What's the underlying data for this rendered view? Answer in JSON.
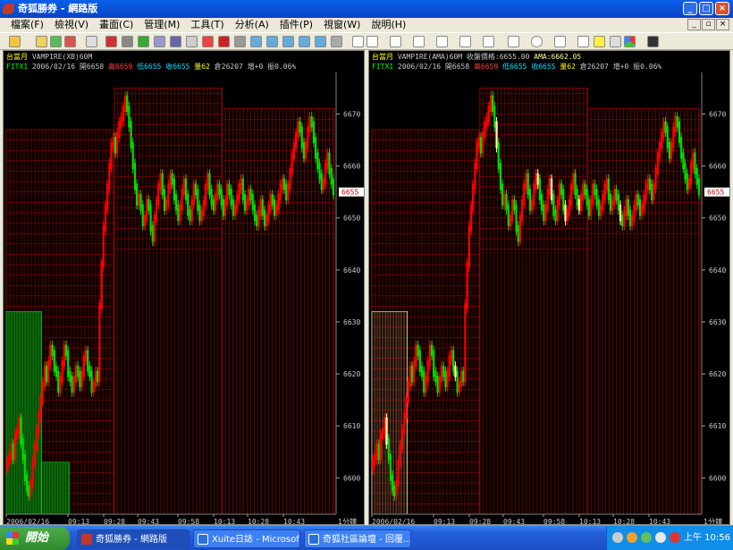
{
  "window": {
    "title": "奇狐勝券 - 網路版"
  },
  "menu": [
    "檔案(F)",
    "檢視(V)",
    "畫面(C)",
    "管理(M)",
    "工具(T)",
    "分析(A)",
    "插件(P)",
    "視窗(W)",
    "說明(H)"
  ],
  "colors": {
    "up": "#ff0000",
    "down": "#00dd00",
    "ama": "#ffffaa",
    "grid": "#c80000",
    "text_green": "#00ff00",
    "axis_label": "#c8c8c8"
  },
  "chart_left": {
    "name": "台當月",
    "indicator": "VAMPIRE(XB)60M",
    "symbol": "FITX1",
    "date": "2006/02/16",
    "open": "開6658",
    "high": "高6659",
    "low": "低6655",
    "close": "收6655",
    "volume": "量62",
    "oi": "倉26207",
    "oi_chg": "增+0",
    "amp": "振0.06%"
  },
  "chart_right": {
    "name": "台當月",
    "indicator": "VAMPIRE(AMA)60M",
    "close_label": "收盤價格:6655.00",
    "ama_label": "AMA:6662.05",
    "symbol": "FITX1",
    "date": "2006/02/16",
    "open": "開6658",
    "high": "高6659",
    "low": "低6655",
    "close": "收6655",
    "volume": "量62",
    "oi": "倉26207",
    "oi_chg": "增+0",
    "amp": "振0.06%"
  },
  "chart_data": {
    "type": "candlestick",
    "y_ticks": [
      6600,
      6610,
      6620,
      6630,
      6640,
      6650,
      6660,
      6670
    ],
    "ylim": [
      6593,
      6678
    ],
    "x_ticks": [
      "2006/02/16",
      "09:13",
      "09:28",
      "09:43",
      "09:58",
      "10:13",
      "10:28",
      "10:43"
    ],
    "timeframe": "1分鐘",
    "last_price": 6655,
    "closes": [
      6603,
      6604,
      6606,
      6604,
      6608,
      6609,
      6611,
      6607,
      6604,
      6600,
      6598,
      6597,
      6599,
      6603,
      6606,
      6609,
      6612,
      6615,
      6618,
      6621,
      6619,
      6622,
      6625,
      6624,
      6621,
      6620,
      6617,
      6619,
      6622,
      6625,
      6624,
      6620,
      6619,
      6617,
      6619,
      6621,
      6620,
      6618,
      6620,
      6623,
      6624,
      6621,
      6620,
      6617,
      6618,
      6620,
      6619,
      6633,
      6641,
      6648,
      6652,
      6656,
      6660,
      6664,
      6665,
      6663,
      6666,
      6668,
      6669,
      6671,
      6673,
      6671,
      6668,
      6664,
      6660,
      6656,
      6653,
      6654,
      6652,
      6649,
      6650,
      6653,
      6652,
      6648,
      6646,
      6650,
      6653,
      6656,
      6658,
      6655,
      6652,
      6653,
      6656,
      6658,
      6657,
      6654,
      6652,
      6650,
      6652,
      6655,
      6657,
      6654,
      6651,
      6650,
      6653,
      6656,
      6655,
      6652,
      6650,
      6651,
      6653,
      6656,
      6658,
      6655,
      6653,
      6652,
      6654,
      6656,
      6655,
      6653,
      6651,
      6653,
      6656,
      6655,
      6653,
      6651,
      6652,
      6654,
      6656,
      6657,
      6654,
      6652,
      6653,
      6655,
      6654,
      6652,
      6650,
      6649,
      6651,
      6653,
      6651,
      6649,
      6650,
      6652,
      6654,
      6653,
      6651,
      6652,
      6654,
      6656,
      6657,
      6656,
      6654,
      6656,
      6659,
      6662,
      6664,
      6666,
      6668,
      6667,
      6664,
      6662,
      6664,
      6667,
      6669,
      6668,
      6665,
      6662,
      6660,
      6658,
      6656,
      6657,
      6660,
      6662,
      6659,
      6657,
      6655
    ]
  }
}
